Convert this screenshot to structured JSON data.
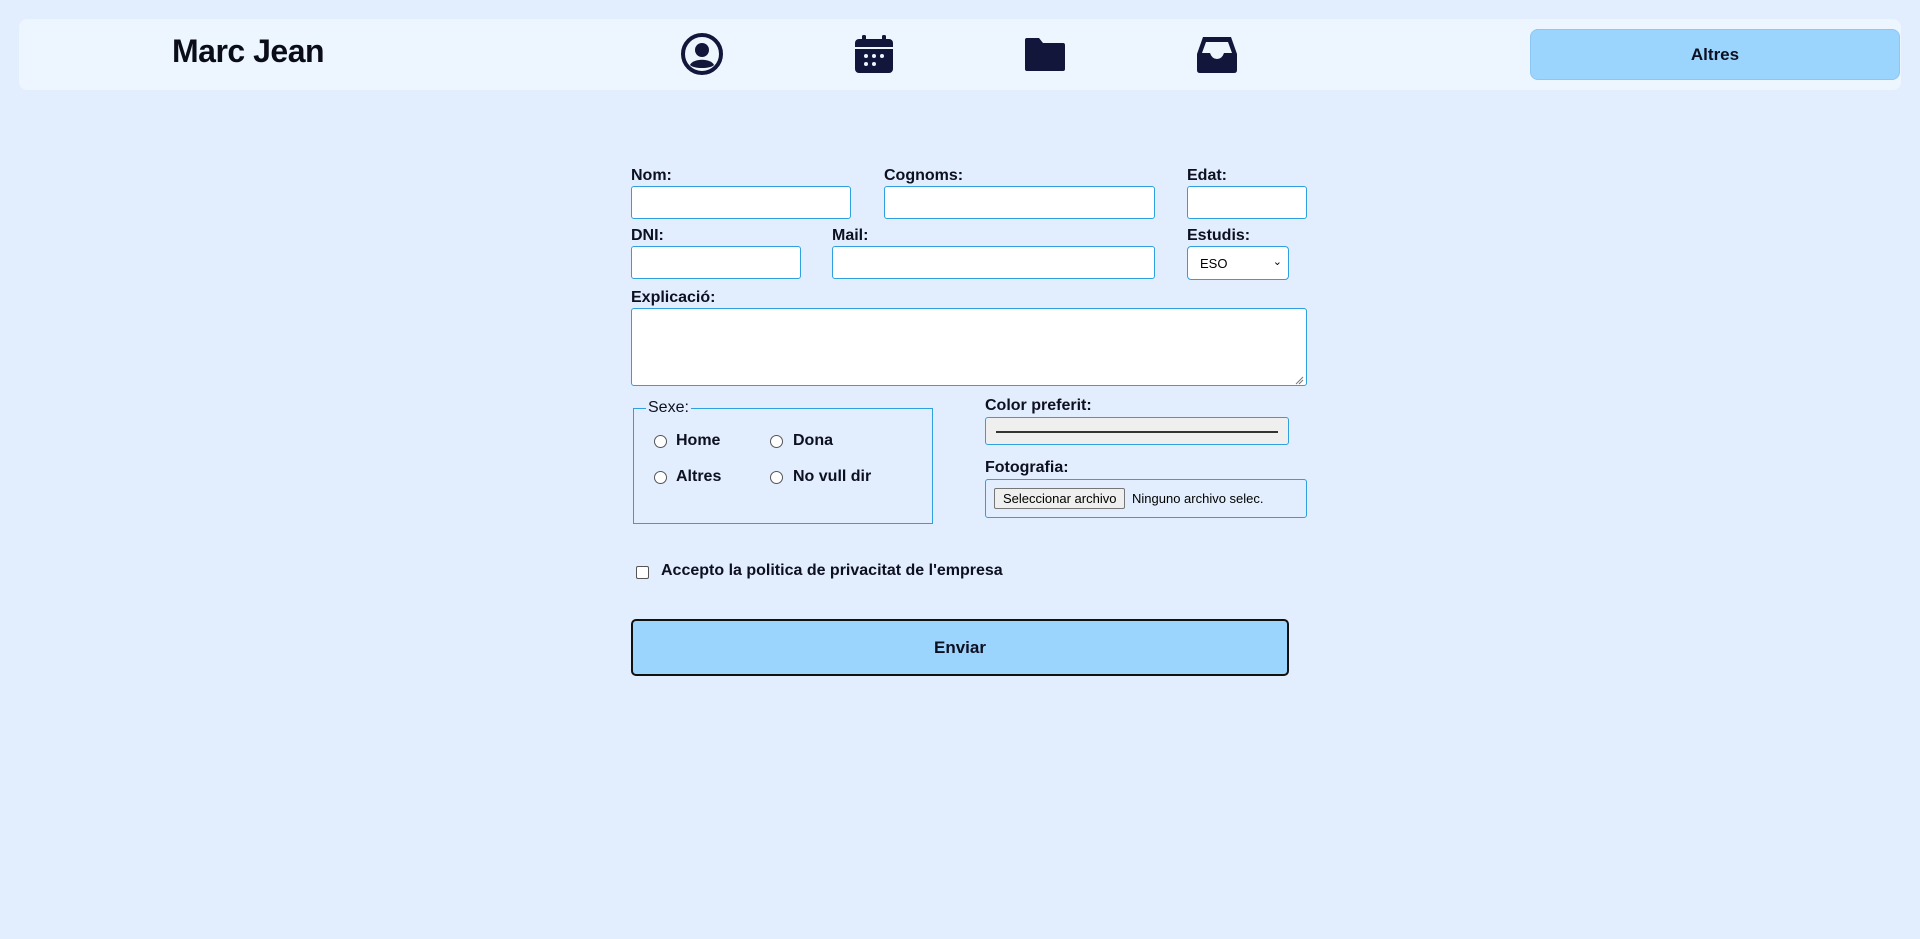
{
  "header": {
    "brand": "Marc Jean",
    "nav_icons": [
      "user-circle-icon",
      "calendar-icon",
      "folder-icon",
      "inbox-icon"
    ],
    "altres_label": "Altres"
  },
  "form": {
    "nom_label": "Nom:",
    "cognoms_label": "Cognoms:",
    "edat_label": "Edat:",
    "dni_label": "DNI:",
    "mail_label": "Mail:",
    "estudis_label": "Estudis:",
    "estudis_value": "ESO",
    "explicacio_label": "Explicació:",
    "sexe": {
      "legend": "Sexe:",
      "options": [
        "Home",
        "Dona",
        "Altres",
        "No vull dir"
      ]
    },
    "color_label": "Color preferit:",
    "color_value": "#333333",
    "foto_label": "Fotografia:",
    "file_button": "Seleccionar archivo",
    "file_status": "Ninguno archivo selec.",
    "privacy_label": "Accepto la politica de privacitat de l'empresa",
    "submit_label": "Enviar"
  },
  "colors": {
    "background": "#e2eefd",
    "header_bg": "#edf5ff",
    "accent": "#9bd4fd",
    "input_border": "#2f9fe0",
    "icon": "#12163a"
  }
}
